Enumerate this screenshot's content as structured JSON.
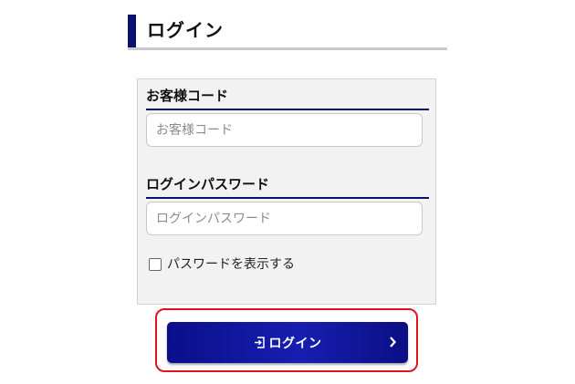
{
  "header": {
    "title": "ログイン"
  },
  "form": {
    "customer_code": {
      "label": "お客様コード",
      "placeholder": "お客様コード",
      "value": ""
    },
    "password": {
      "label": "ログインパスワード",
      "placeholder": "ログインパスワード",
      "value": ""
    },
    "show_password": {
      "label": "パスワードを表示する",
      "checked": false
    }
  },
  "login_button": {
    "label": "ログイン",
    "icon": "login-icon",
    "trailing_icon": "chevron-right-icon"
  },
  "colors": {
    "accent_navy": "#0c1170",
    "button_blue": "#171eb0",
    "highlight_red": "#e0141e",
    "panel_bg": "#f2f2f2"
  }
}
